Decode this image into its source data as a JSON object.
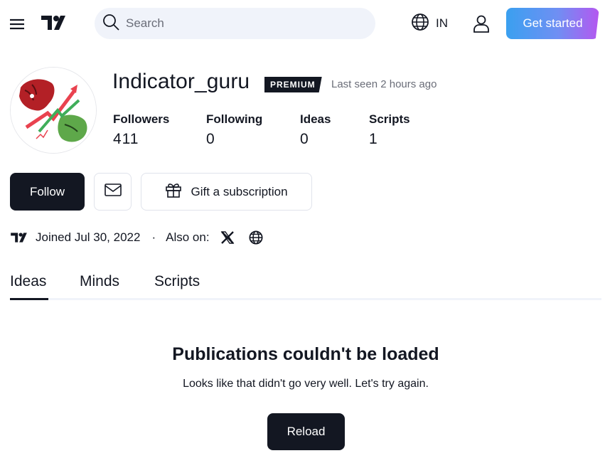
{
  "header": {
    "search_placeholder": "Search",
    "language": "IN",
    "get_started": "Get started"
  },
  "profile": {
    "username": "Indicator_guru",
    "badge": "PREMIUM",
    "last_seen": "Last seen 2 hours ago",
    "stats": [
      {
        "label": "Followers",
        "value": "411"
      },
      {
        "label": "Following",
        "value": "0"
      },
      {
        "label": "Ideas",
        "value": "0"
      },
      {
        "label": "Scripts",
        "value": "1"
      }
    ]
  },
  "actions": {
    "follow": "Follow",
    "gift": "Gift a subscription"
  },
  "meta": {
    "joined": "Joined Jul 30, 2022",
    "separator": "·",
    "also_on": "Also on:"
  },
  "tabs": [
    "Ideas",
    "Minds",
    "Scripts"
  ],
  "empty_state": {
    "title": "Publications couldn't be loaded",
    "subtitle": "Looks like that didn't go very well. Let's try again.",
    "reload": "Reload"
  },
  "colors": {
    "text": "#131722",
    "muted": "#6a6d78",
    "search_bg": "#f0f3fa",
    "button_dark": "#131722"
  }
}
